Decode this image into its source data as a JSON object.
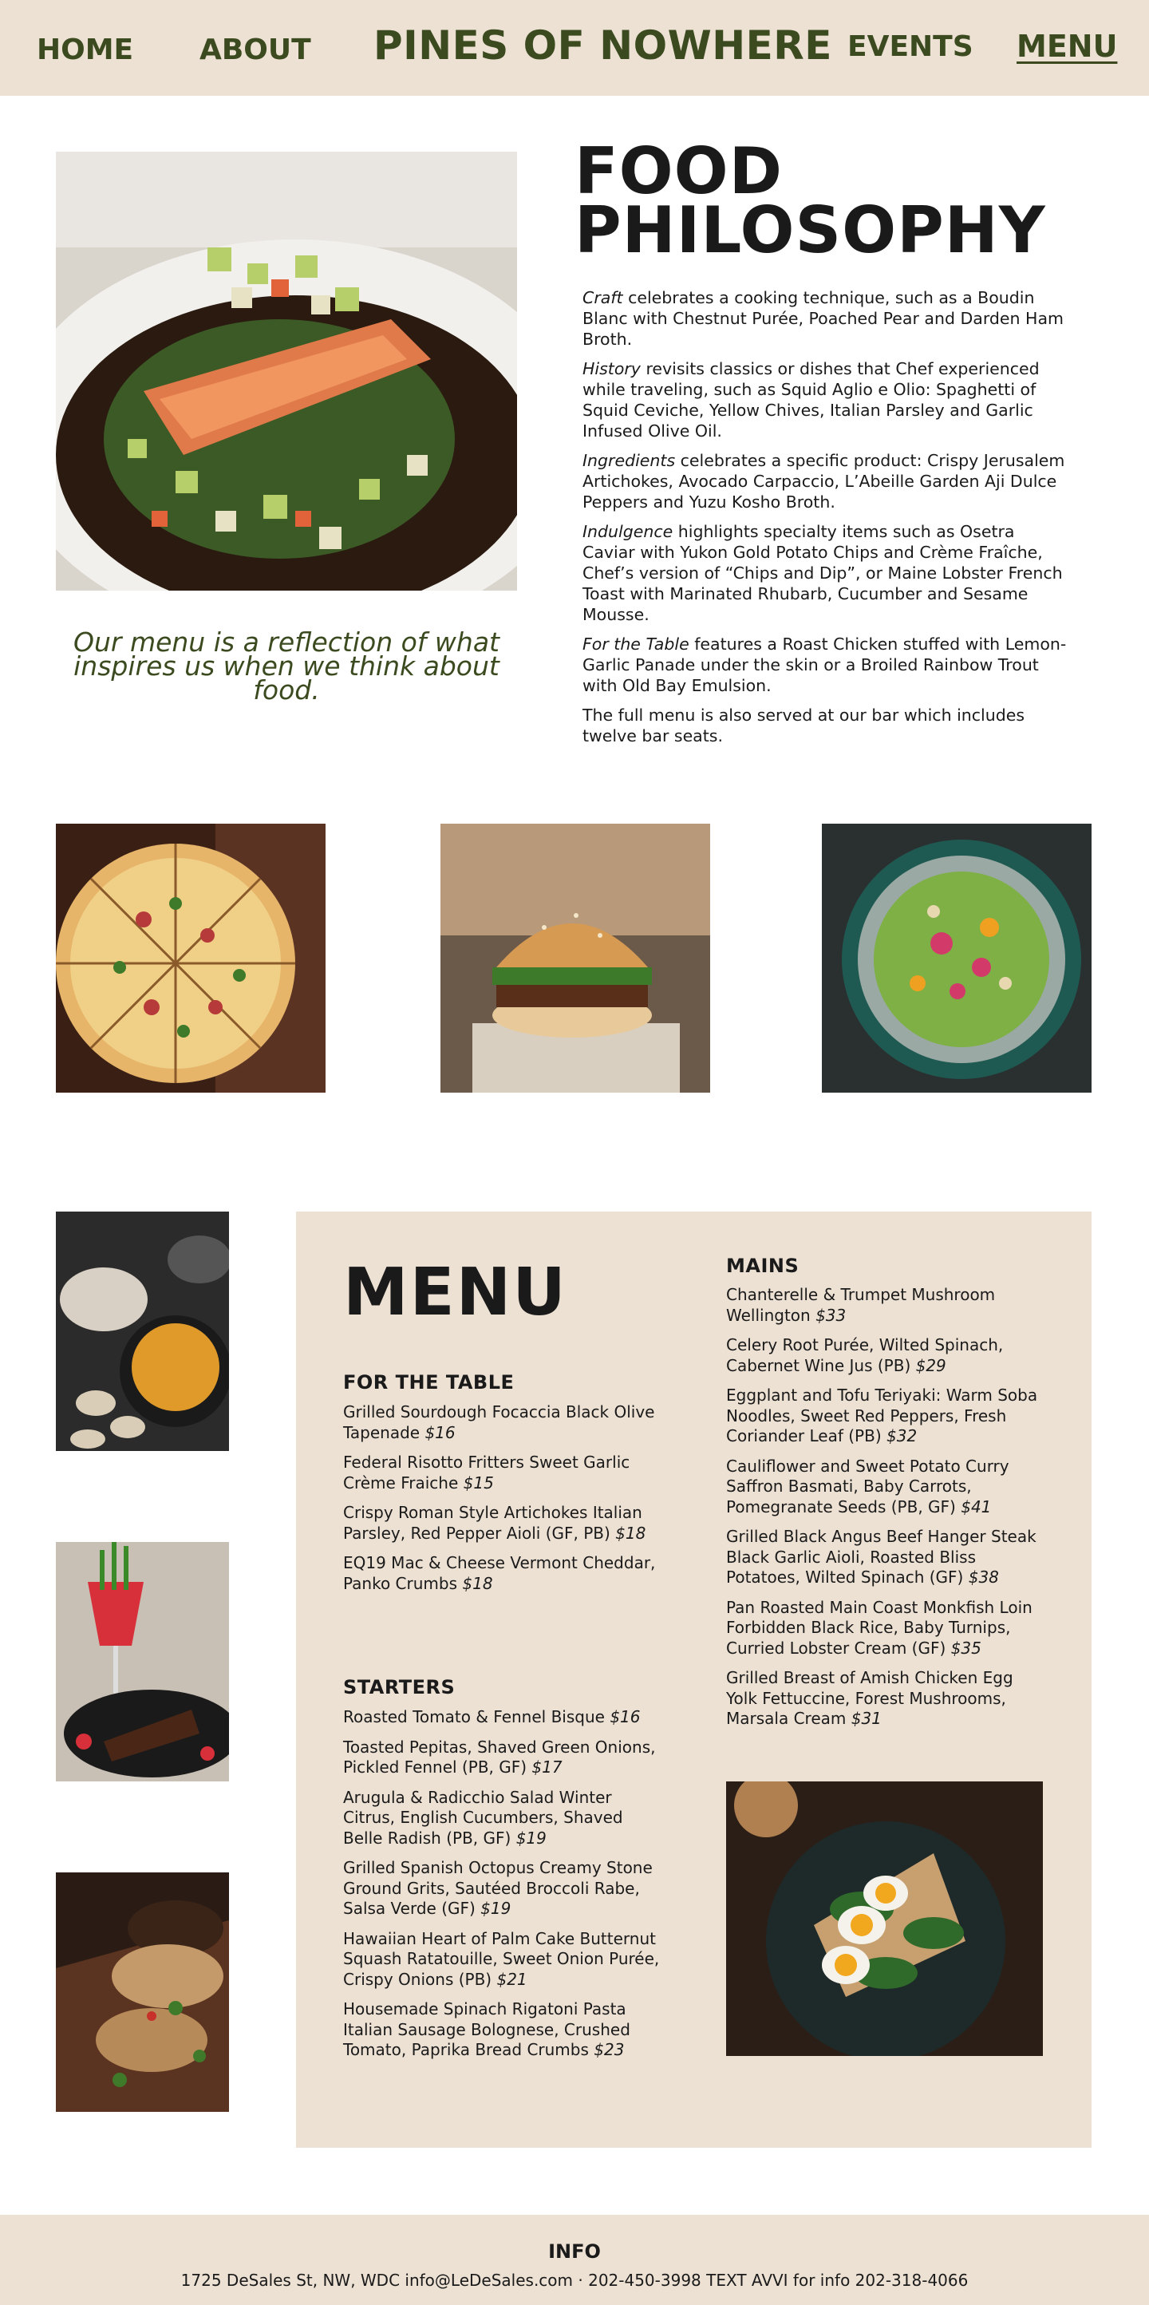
{
  "nav": {
    "home": "HOME",
    "about": "ABOUT",
    "brand": "PINES OF NOWHERE",
    "events": "EVENTS",
    "menu": "MENU"
  },
  "philosophy": {
    "title_line1": "FOOD",
    "title_line2": "PHILOSOPHY",
    "quote": "Our menu is a reflection of what inspires us when we think about food.",
    "paragraphs": [
      {
        "lead": "Craft",
        "text": " celebrates a cooking technique, such as a Boudin Blanc with Chestnut Purée, Poached Pear and Darden Ham Broth."
      },
      {
        "lead": "History",
        "text": " revisits classics or dishes that Chef experienced while traveling, such as Squid Aglio e Olio: Spaghetti of Squid Ceviche, Yellow Chives, Italian Parsley and Garlic Infused Olive Oil."
      },
      {
        "lead": "Ingredients",
        "text": " celebrates a specific product: Crispy Jerusalem Artichokes, Avocado Carpaccio, L’Abeille Garden Aji Dulce Peppers and Yuzu Kosho Broth."
      },
      {
        "lead": "Indulgence",
        "text": " highlights specialty items such as Osetra Caviar with Yukon Gold Potato Chips and Crème Fraîche, Chef’s version of “Chips and Dip”, or Maine Lobster French Toast with Marinated Rhubarb, Cucumber and Sesame Mousse."
      },
      {
        "lead": "For the Table",
        "text": " features a Roast Chicken stuffed with Lemon-Garlic Panade under the skin or a Broiled Rainbow Trout with Old Bay Emulsion."
      },
      {
        "lead": "",
        "text": "The full menu is also served at our bar which includes twelve bar seats."
      }
    ]
  },
  "menu": {
    "title": "MENU",
    "for_the_table": {
      "heading": "FOR THE TABLE",
      "items": [
        {
          "name": "Grilled Sourdough Focaccia Black Olive Tapenade",
          "price": "$16"
        },
        {
          "name": "Federal Risotto Fritters Sweet Garlic Crème Fraiche",
          "price": "$15"
        },
        {
          "name": "Crispy Roman Style Artichokes Italian Parsley, Red Pepper Aioli (GF, PB)",
          "price": "$18"
        },
        {
          "name": "EQ19 Mac & Cheese Vermont Cheddar, Panko Crumbs",
          "price": "$18"
        }
      ]
    },
    "starters": {
      "heading": "STARTERS",
      "items": [
        {
          "name": "Roasted Tomato & Fennel Bisque",
          "price": "$16"
        },
        {
          "name": "Toasted Pepitas, Shaved Green Onions, Pickled Fennel (PB, GF)",
          "price": "$17"
        },
        {
          "name": "Arugula & Radicchio Salad Winter Citrus, English Cucumbers, Shaved Belle Radish (PB, GF)",
          "price": "$19"
        },
        {
          "name": "Grilled Spanish Octopus Creamy Stone Ground Grits, Sautéed Broccoli Rabe, Salsa Verde (GF)",
          "price": "$19"
        },
        {
          "name": "Hawaiian Heart of Palm Cake Butternut Squash Ratatouille, Sweet Onion Purée, Crispy Onions (PB)",
          "price": "$21"
        },
        {
          "name": "Housemade Spinach Rigatoni Pasta Italian Sausage Bolognese, Crushed Tomato, Paprika Bread Crumbs",
          "price": "$23"
        }
      ]
    },
    "mains": {
      "heading": "MAINS",
      "items": [
        {
          "name": "Chanterelle & Trumpet Mushroom Wellington",
          "price": "$33"
        },
        {
          "name": "Celery Root Purée, Wilted Spinach, Cabernet Wine Jus (PB)",
          "price": "$29"
        },
        {
          "name": "Eggplant and Tofu Teriyaki: Warm Soba Noodles, Sweet Red Peppers, Fresh Coriander Leaf (PB)",
          "price": "$32"
        },
        {
          "name": "Cauliflower and Sweet Potato Curry Saffron Basmati, Baby Carrots, Pomegranate Seeds (PB, GF)",
          "price": "$41"
        },
        {
          "name": "Grilled Black Angus Beef Hanger Steak Black Garlic Aioli, Roasted Bliss Potatoes, Wilted Spinach (GF)",
          "price": "$38"
        },
        {
          "name": "Pan Roasted Main Coast Monkfish Loin Forbidden Black Rice, Baby Turnips, Curried Lobster Cream (GF)",
          "price": "$35"
        },
        {
          "name": "Grilled Breast of Amish Chicken Egg Yolk Fettuccine, Forest Mushrooms, Marsala Cream",
          "price": "$31"
        }
      ]
    }
  },
  "footer": {
    "heading": "INFO",
    "line": "1725 DeSales St, NW, WDC  info@LeDeSales.com · 202-450-3998  TEXT AVVI for info  202-318-4066"
  },
  "colors": {
    "accent_green": "#3b4a1f",
    "panel_beige": "#ede1d4"
  }
}
